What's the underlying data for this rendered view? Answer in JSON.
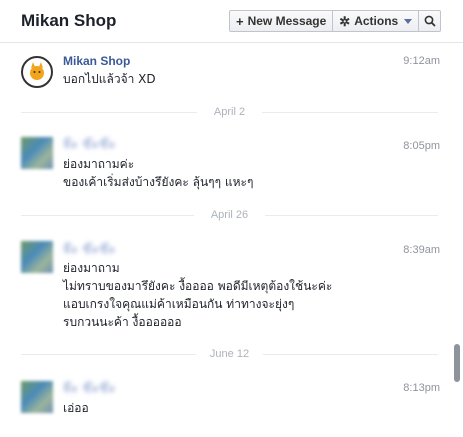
{
  "header": {
    "title": "Mikan Shop",
    "new_message_label": "New Message",
    "actions_label": "Actions"
  },
  "icons": {
    "new_message": "plus-icon",
    "actions": "gear-icon",
    "actions_caret": "chevron-down-icon",
    "search": "search-icon"
  },
  "colors": {
    "sender_link": "#3b5998",
    "timestamp": "#90949c",
    "divider_text": "#adb2bb"
  },
  "messages": [
    {
      "sender": "Mikan Shop",
      "time": "9:12am",
      "lines": [
        "บอกไปแล้วจ้า XD"
      ]
    },
    {
      "sender": "จ๊ะ ข๊ะข๊ะ",
      "time": "8:05pm",
      "lines": [
        "ย่องมาถามค่ะ",
        "ของเค้าเริ่มส่งบ้างรึยังคะ ลุ้นๆๆ แหะๆ"
      ]
    },
    {
      "sender": "จ๊ะ ข๊ะข๊ะ",
      "time": "8:39am",
      "lines": [
        "ย่องมาถาม",
        "ไม่ทราบของมารึยังคะ งื้ออออ พอดีมีเหตุต้องใช้นะค่ะ",
        "แอบเกรงใจคุณแม่ค้าเหมือนกัน ท่าทางจะยุ่งๆ",
        "รบกวนนะค้า งื้ออออออ"
      ]
    },
    {
      "sender": "จ๊ะ ข๊ะข๊ะ",
      "time": "8:13pm",
      "lines": [
        "เอ่ออ"
      ]
    }
  ],
  "dividers": [
    "April 2",
    "April 26",
    "June 12"
  ]
}
